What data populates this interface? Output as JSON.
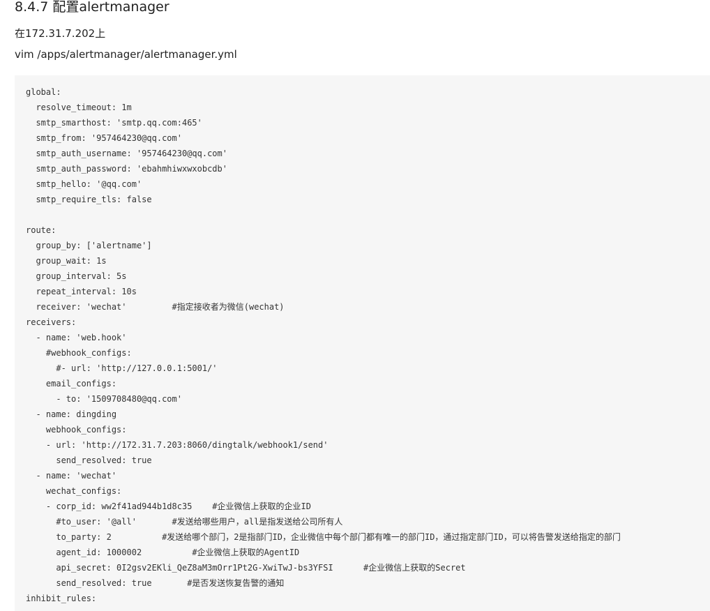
{
  "heading": "8.4.7 配置alertmanager",
  "paragraphs": [
    "在172.31.7.202上",
    "vim /apps/alertmanager/alertmanager.yml"
  ],
  "code_lines": [
    "global:",
    "  resolve_timeout: 1m",
    "  smtp_smarthost: 'smtp.qq.com:465'",
    "  smtp_from: '957464230@qq.com'",
    "  smtp_auth_username: '957464230@qq.com'",
    "  smtp_auth_password: 'ebahmhiwxwxobcdb'",
    "  smtp_hello: '@qq.com'",
    "  smtp_require_tls: false",
    "",
    "route:",
    "  group_by: ['alertname']",
    "  group_wait: 1s",
    "  group_interval: 5s",
    "  repeat_interval: 10s",
    "  receiver: 'wechat'         #指定接收者为微信(wechat)",
    "receivers:",
    "  - name: 'web.hook'",
    "    #webhook_configs:",
    "      #- url: 'http://127.0.0.1:5001/'",
    "    email_configs:",
    "      - to: '1509708480@qq.com'",
    "  - name: dingding",
    "    webhook_configs:",
    "    - url: 'http://172.31.7.203:8060/dingtalk/webhook1/send'",
    "      send_resolved: true",
    "  - name: 'wechat'",
    "    wechat_configs:",
    "    - corp_id: ww2f41ad944b1d8c35    #企业微信上获取的企业ID",
    "      #to_user: '@all'       #发送给哪些用户，all是指发送给公司所有人",
    "      to_party: 2          #发送给哪个部门，2是指部门ID，企业微信中每个部门都有唯一的部门ID，通过指定部门ID，可以将告警发送给指定的部门",
    "      agent_id: 1000002          #企业微信上获取的AgentID",
    "      api_secret: 0I2gsv2EKli_QeZ8aM3mOrr1Pt2G-XwiTwJ-bs3YFSI      #企业微信上获取的Secret",
    "      send_resolved: true       #是否发送恢复告警的通知",
    "inhibit_rules:"
  ]
}
